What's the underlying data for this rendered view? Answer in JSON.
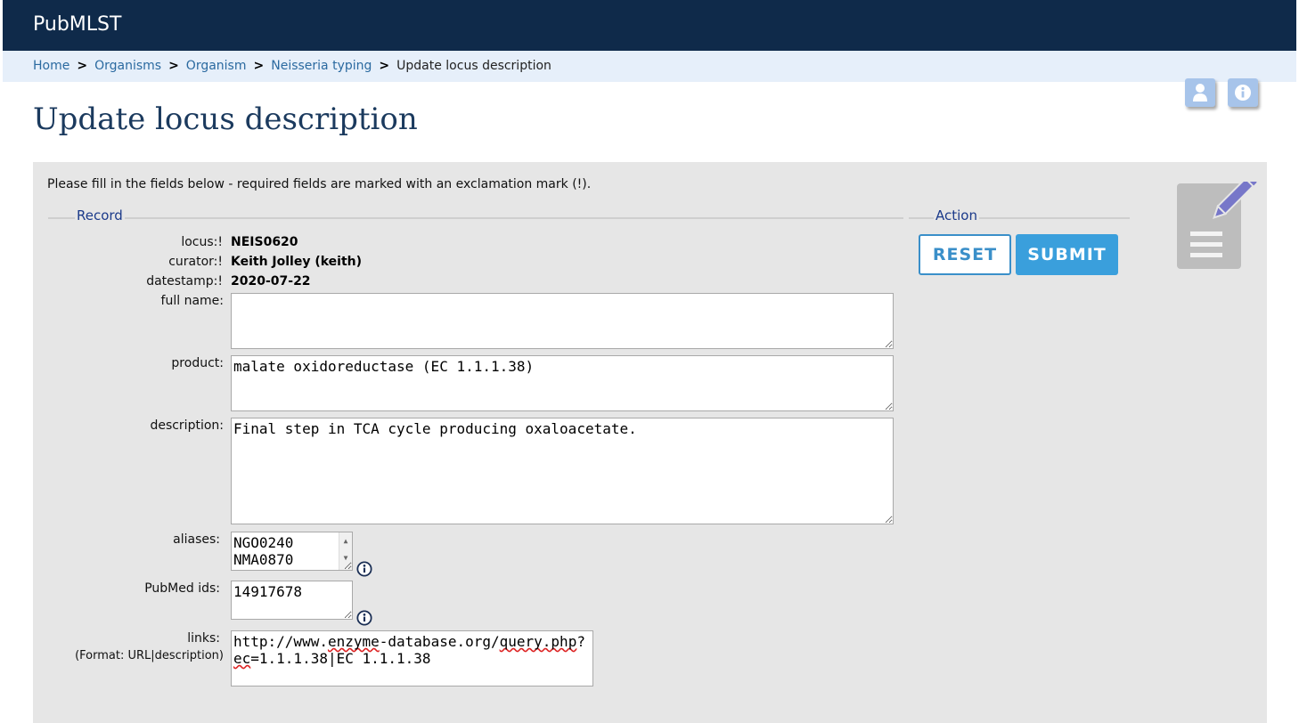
{
  "header": {
    "brand": "PubMLST"
  },
  "breadcrumb": {
    "items": [
      "Home",
      "Organisms",
      "Organism",
      "Neisseria typing"
    ],
    "separator": ">",
    "current": "Update locus description"
  },
  "toolbar_icons": [
    "user-icon",
    "info-icon"
  ],
  "page": {
    "title": "Update locus description"
  },
  "form": {
    "instructions": "Please fill in the fields below - required fields are marked with an exclamation mark (!).",
    "record_legend": "Record",
    "action_legend": "Action",
    "fields": {
      "locus": {
        "label": "locus:!",
        "value": "NEIS0620"
      },
      "curator": {
        "label": "curator:!",
        "value": "Keith Jolley (keith)"
      },
      "datestamp": {
        "label": "datestamp:!",
        "value": "2020-07-22"
      },
      "full_name": {
        "label": "full name:",
        "value": ""
      },
      "product": {
        "label": "product:",
        "value": "malate oxidoreductase (EC 1.1.1.38)"
      },
      "description": {
        "label": "description:",
        "value": "Final step in TCA cycle producing oxaloacetate."
      },
      "aliases": {
        "label": "aliases:",
        "values": [
          "NGO0240",
          "NMA0870"
        ]
      },
      "pubmed_ids": {
        "label": "PubMed ids:",
        "value": "14917678"
      },
      "links": {
        "label": "links:",
        "sublabel": "(Format: URL|description)",
        "line1_a": "http://www.",
        "line1_b": "enzyme",
        "line1_c": "-database.org/",
        "line1_d": "query.php",
        "line1_e": "?",
        "line2_a": "ec",
        "line2_b": "=1.1.1.38|EC 1.1.1.38"
      }
    },
    "buttons": {
      "reset": "RESET",
      "submit": "SUBMIT"
    }
  },
  "colors": {
    "topbar": "#0f2a4a",
    "breadcrumb_bg": "#e6effa",
    "accent": "#3a9fdc",
    "panel_bg": "#e6e6e6",
    "title": "#1b3a5e"
  }
}
